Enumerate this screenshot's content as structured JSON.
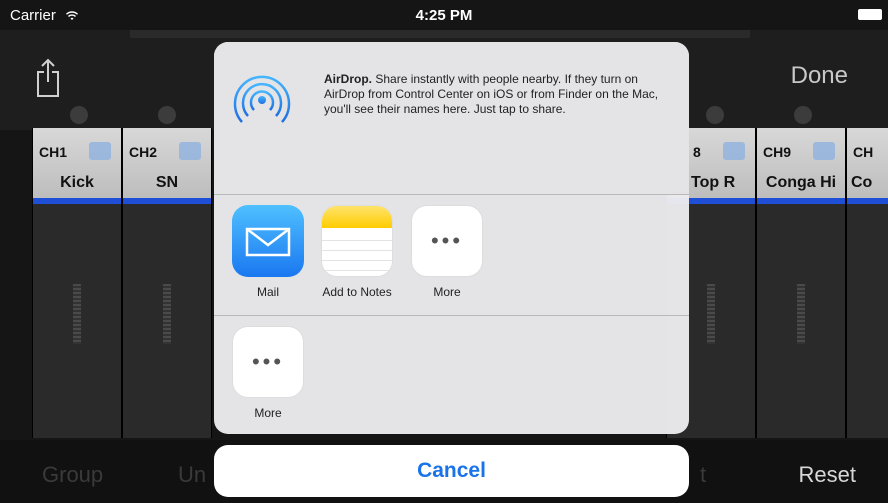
{
  "status": {
    "carrier": "Carrier",
    "time": "4:25 PM"
  },
  "header": {
    "done_label": "Done"
  },
  "channels": [
    {
      "ch": "CH1",
      "name": "Kick"
    },
    {
      "ch": "CH2",
      "name": "SN"
    },
    {
      "ch": "8",
      "name": "Top R"
    },
    {
      "ch": "CH9",
      "name": "Conga Hi"
    },
    {
      "ch": "CH",
      "name": "Co"
    }
  ],
  "bottom": {
    "group_label": "Group",
    "un_label": "Un",
    "t_label": "t",
    "reset_label": "Reset"
  },
  "share_sheet": {
    "airdrop_title": "AirDrop.",
    "airdrop_text": "Share instantly with people nearby. If they turn on AirDrop from Control Center on iOS or from Finder on the Mac, you'll see their names here. Just tap to share.",
    "apps": [
      {
        "label": "Mail",
        "icon": "mail-icon"
      },
      {
        "label": "Add to Notes",
        "icon": "notes-icon"
      },
      {
        "label": "More",
        "icon": "more-icon"
      }
    ],
    "actions": [
      {
        "label": "More",
        "icon": "more-icon"
      }
    ],
    "cancel_label": "Cancel"
  },
  "colors": {
    "accent": "#1a73e8",
    "channel_bar": "#1f4fd6"
  }
}
